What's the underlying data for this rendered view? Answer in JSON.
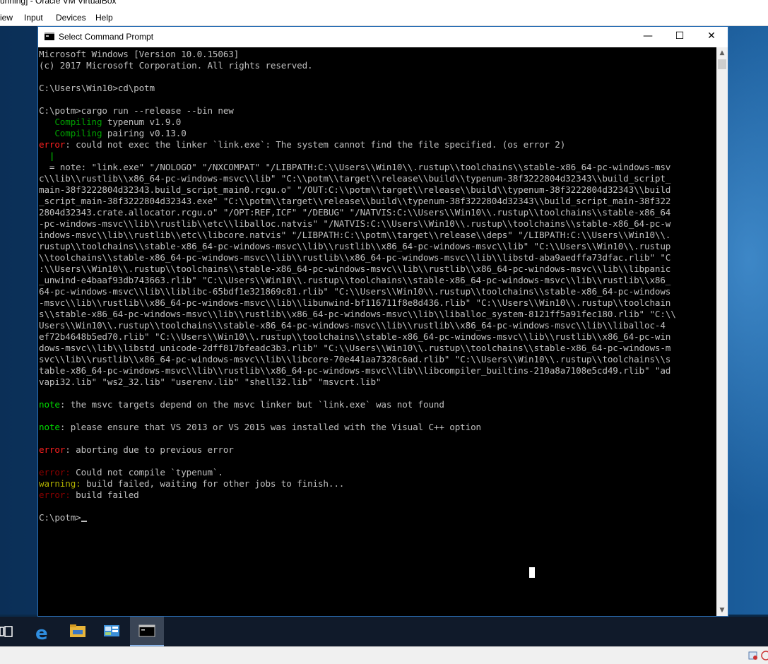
{
  "vbox": {
    "title": "unning] - Oracle VM VirtualBox",
    "menu": [
      "iew",
      "Input",
      "Devices",
      "Help"
    ]
  },
  "cmd_window": {
    "title": "Select Command Prompt",
    "minimize": "—",
    "maximize": "☐",
    "close": "✕"
  },
  "console": {
    "header1": "Microsoft Windows [Version 10.0.15063]",
    "header2": "(c) 2017 Microsoft Corporation. All rights reserved.",
    "cmd_cd": "C:\\Users\\Win10>cd\\potm",
    "cmd_cargo": "C:\\potm>cargo run --release --bin new",
    "compiling_label": "Compiling",
    "compile1": " typenum v1.9.0",
    "compile2": " pairing v0.13.0",
    "error_label": "error",
    "error_link": ": could not exec the linker `link.exe`: The system cannot find the file specified. (os error 2)",
    "pipe": "|",
    "note_prefix": "  = note: ",
    "note_lines": [
      "\"link.exe\" \"/NOLOGO\" \"/NXCOMPAT\" \"/LIBPATH:C:\\\\Users\\\\Win10\\\\.rustup\\\\toolchains\\\\stable-x86_64-pc-windows-msv",
      "c\\\\lib\\\\rustlib\\\\x86_64-pc-windows-msvc\\\\lib\" \"C:\\\\potm\\\\target\\\\release\\\\build\\\\typenum-38f3222804d32343\\\\build_script_",
      "main-38f3222804d32343.build_script_main0.rcgu.o\" \"/OUT:C:\\\\potm\\\\target\\\\release\\\\build\\\\typenum-38f3222804d32343\\\\build",
      "_script_main-38f3222804d32343.exe\" \"C:\\\\potm\\\\target\\\\release\\\\build\\\\typenum-38f3222804d32343\\\\build_script_main-38f322",
      "2804d32343.crate.allocator.rcgu.o\" \"/OPT:REF,ICF\" \"/DEBUG\" \"/NATVIS:C:\\\\Users\\\\Win10\\\\.rustup\\\\toolchains\\\\stable-x86_64",
      "-pc-windows-msvc\\\\lib\\\\rustlib\\\\etc\\\\liballoc.natvis\" \"/NATVIS:C:\\\\Users\\\\Win10\\\\.rustup\\\\toolchains\\\\stable-x86_64-pc-w",
      "indows-msvc\\\\lib\\\\rustlib\\\\etc\\\\libcore.natvis\" \"/LIBPATH:C:\\\\potm\\\\target\\\\release\\\\deps\" \"/LIBPATH:C:\\\\Users\\\\Win10\\\\.",
      "rustup\\\\toolchains\\\\stable-x86_64-pc-windows-msvc\\\\lib\\\\rustlib\\\\x86_64-pc-windows-msvc\\\\lib\" \"C:\\\\Users\\\\Win10\\\\.rustup",
      "\\\\toolchains\\\\stable-x86_64-pc-windows-msvc\\\\lib\\\\rustlib\\\\x86_64-pc-windows-msvc\\\\lib\\\\libstd-aba9aedffa73dfac.rlib\" \"C",
      ":\\\\Users\\\\Win10\\\\.rustup\\\\toolchains\\\\stable-x86_64-pc-windows-msvc\\\\lib\\\\rustlib\\\\x86_64-pc-windows-msvc\\\\lib\\\\libpanic",
      "_unwind-e4baaf93db743663.rlib\" \"C:\\\\Users\\\\Win10\\\\.rustup\\\\toolchains\\\\stable-x86_64-pc-windows-msvc\\\\lib\\\\rustlib\\\\x86_",
      "64-pc-windows-msvc\\\\lib\\\\liblibc-65bdf1e321869c81.rlib\" \"C:\\\\Users\\\\Win10\\\\.rustup\\\\toolchains\\\\stable-x86_64-pc-windows",
      "-msvc\\\\lib\\\\rustlib\\\\x86_64-pc-windows-msvc\\\\lib\\\\libunwind-bf116711f8e8d436.rlib\" \"C:\\\\Users\\\\Win10\\\\.rustup\\\\toolchain",
      "s\\\\stable-x86_64-pc-windows-msvc\\\\lib\\\\rustlib\\\\x86_64-pc-windows-msvc\\\\lib\\\\liballoc_system-8121ff5a91fec180.rlib\" \"C:\\\\",
      "Users\\\\Win10\\\\.rustup\\\\toolchains\\\\stable-x86_64-pc-windows-msvc\\\\lib\\\\rustlib\\\\x86_64-pc-windows-msvc\\\\lib\\\\liballoc-4",
      "ef72b4648b5ed70.rlib\" \"C:\\\\Users\\\\Win10\\\\.rustup\\\\toolchains\\\\stable-x86_64-pc-windows-msvc\\\\lib\\\\rustlib\\\\x86_64-pc-win",
      "dows-msvc\\\\lib\\\\libstd_unicode-2dff817bfeadc3b3.rlib\" \"C:\\\\Users\\\\Win10\\\\.rustup\\\\toolchains\\\\stable-x86_64-pc-windows-m",
      "svc\\\\lib\\\\rustlib\\\\x86_64-pc-windows-msvc\\\\lib\\\\libcore-70e441aa7328c6ad.rlib\" \"C:\\\\Users\\\\Win10\\\\.rustup\\\\toolchains\\\\s",
      "table-x86_64-pc-windows-msvc\\\\lib\\\\rustlib\\\\x86_64-pc-windows-msvc\\\\lib\\\\libcompiler_builtins-210a8a7108e5cd49.rlib\" \"ad",
      "vapi32.lib\" \"ws2_32.lib\" \"userenv.lib\" \"shell32.lib\" \"msvcrt.lib\""
    ],
    "note_label": "note",
    "note_msvc": ": the msvc targets depend on the msvc linker but `link.exe` was not found",
    "note_vs": ": please ensure that VS 2013 or VS 2015 was installed with the Visual C++ option",
    "error_abort": ": aborting due to previous error",
    "error_label_colon": "error:",
    "compile_fail": " Could not compile `typenum`.",
    "warning_label": "warning:",
    "warning_text": " build failed, waiting for other jobs to finish...",
    "build_failed": " build failed",
    "prompt": "C:\\potm>"
  },
  "scrollbar": {
    "up": "▲",
    "down": "▼"
  },
  "taskbar": {
    "items": [
      "task-view-icon",
      "edge-icon",
      "file-explorer-icon",
      "control-panel-icon",
      "command-prompt-icon"
    ]
  },
  "colors": {
    "error": "#ff2020",
    "error_dim": "#8b0000",
    "note": "#00dd00",
    "compiling": "#00a000",
    "warning": "#b0b000"
  }
}
